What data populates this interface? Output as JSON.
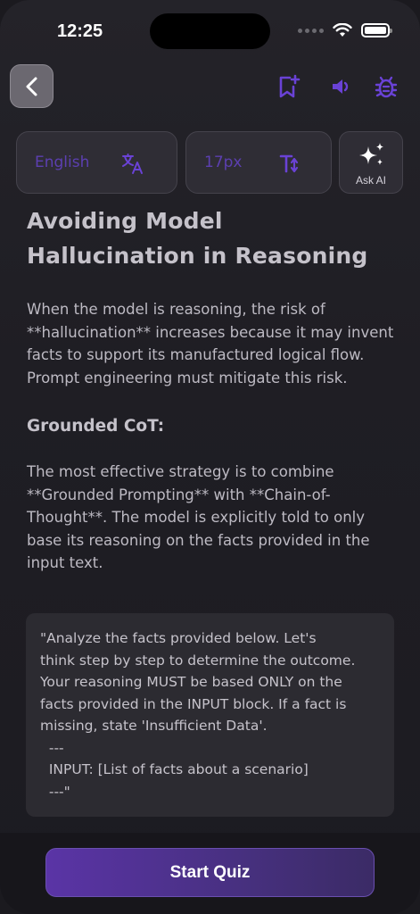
{
  "status_bar": {
    "time": "12:25"
  },
  "toolbar": {
    "back_icon": "chevron-left-icon",
    "bookmark_icon": "bookmark-add-icon",
    "speaker_icon": "speaker-icon",
    "bug_icon": "bug-icon"
  },
  "controls": {
    "language_label": "English",
    "font_size_label": "17px",
    "ask_ai_label": "Ask AI"
  },
  "article": {
    "title": "Avoiding Model Hallucination in Reasoning",
    "intro": "When the model is reasoning, the risk of **hallucination** increases because it may invent facts to support its manufactured logical flow. Prompt engineering must mitigate this risk.",
    "subheading": "Grounded CoT:",
    "body": "The most effective strategy is to combine **Grounded Prompting** with **Chain-of-Thought**. The model is explicitly told to only base its reasoning on the facts provided in the input text.",
    "code_lines": [
      "\"Analyze the facts provided below. Let's",
      "think step by step to determine the outcome.",
      "Your reasoning MUST be based ONLY on the",
      "facts provided in the INPUT block. If a fact is",
      "missing, state 'Insufficient Data'.",
      "  ---",
      "  INPUT: [List of facts about a scenario]",
      "  ---\""
    ]
  },
  "footer": {
    "start_label": "Start Quiz"
  },
  "colors": {
    "accent": "#6a42d6",
    "accent_dim": "#5c3fb1",
    "background": "#1f1e24"
  }
}
